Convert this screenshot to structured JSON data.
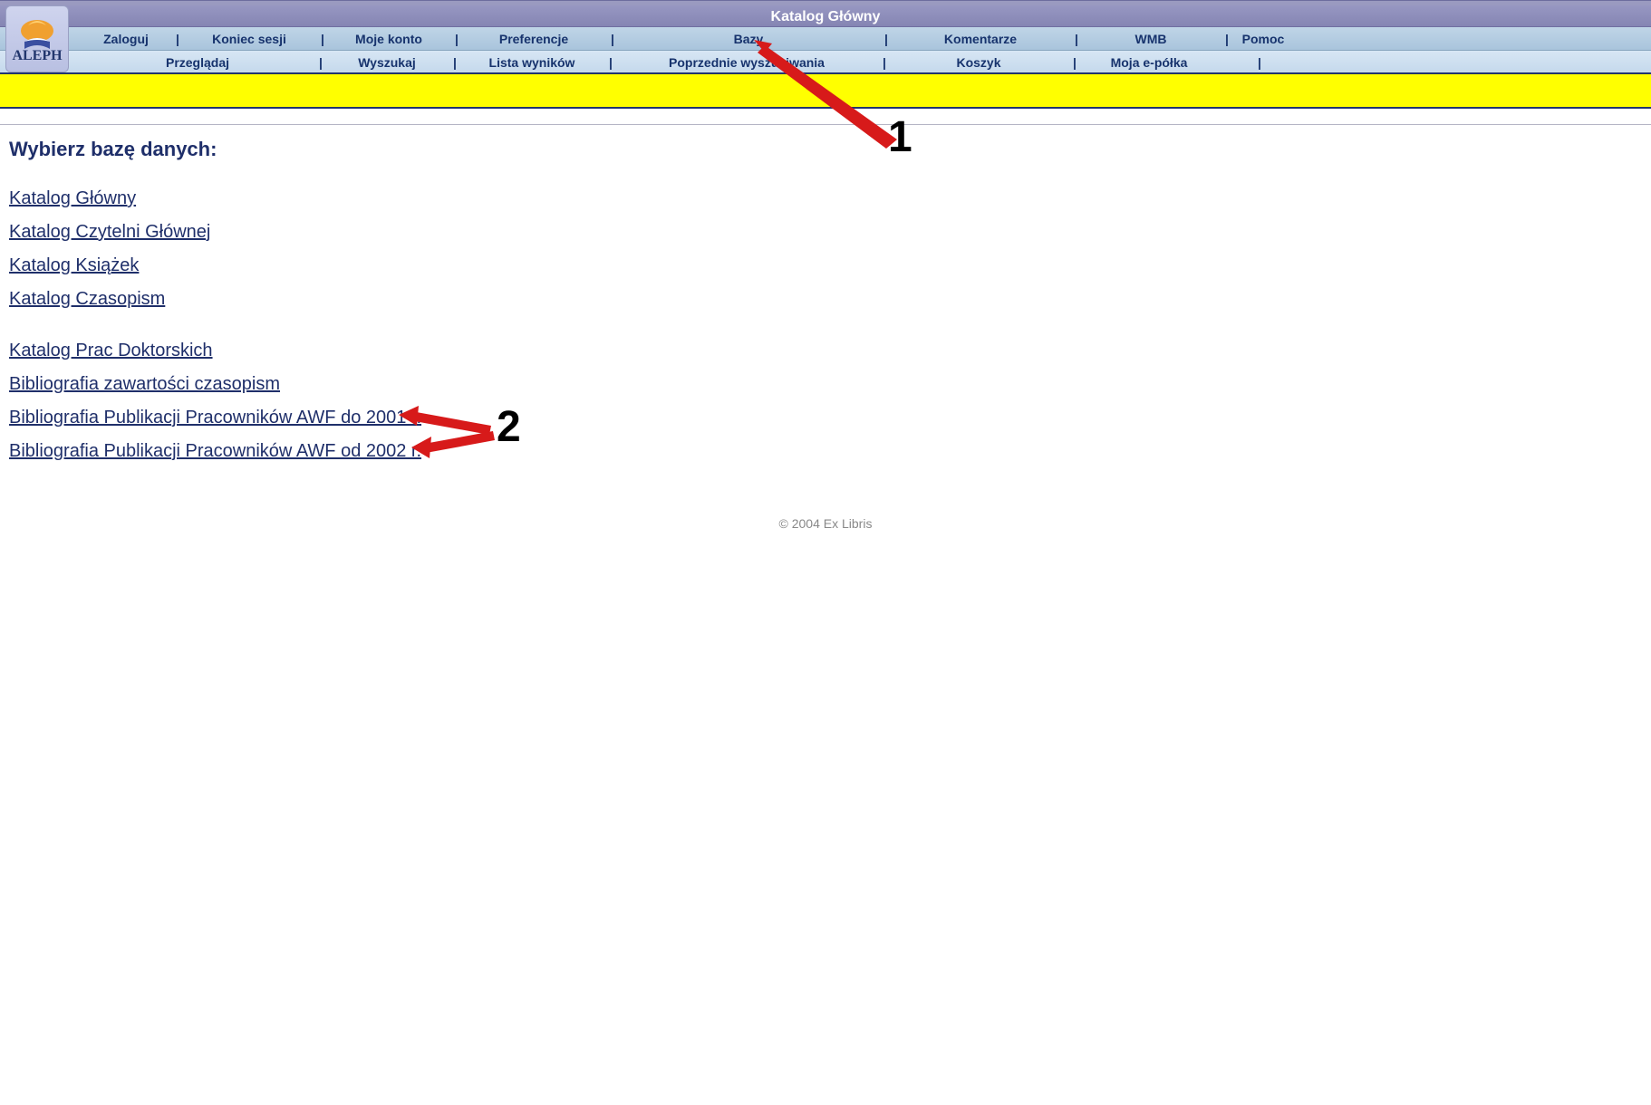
{
  "title": "Katalog Główny",
  "logo_text": "ALEPH",
  "nav_row1": [
    "Zaloguj",
    "Koniec sesji",
    "Moje konto",
    "Preferencje",
    "Bazy",
    "Komentarze",
    "WMB",
    "Pomoc"
  ],
  "nav_row2": [
    "Przeglądaj",
    "Wyszukaj",
    "Lista wyników",
    "Poprzednie wyszukiwania",
    "Koszyk",
    "Moja e-półka"
  ],
  "heading": "Wybierz bazę danych:",
  "db_groups": [
    [
      "Katalog Główny",
      "Katalog Czytelni Głównej",
      "Katalog Książek",
      "Katalog Czasopism"
    ],
    [
      "Katalog Prac Doktorskich",
      "Bibliografia zawartości czasopism",
      "Bibliografia Publikacji Pracowników AWF do 2001 r.",
      "Bibliografia Publikacji Pracowników AWF od 2002 r."
    ]
  ],
  "footer": "© 2004 Ex Libris",
  "annotations": {
    "num1": "1",
    "num2": "2"
  },
  "colors": {
    "arrow": "#d71a1a"
  }
}
